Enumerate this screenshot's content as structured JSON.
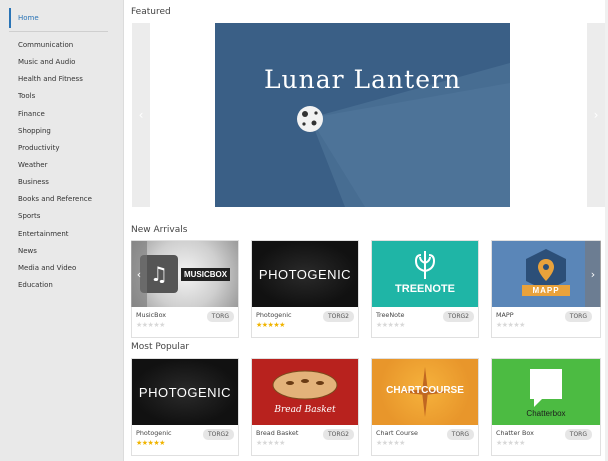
{
  "sidebar": {
    "home": "Home",
    "items": [
      {
        "label": "Communication"
      },
      {
        "label": "Music and Audio"
      },
      {
        "label": "Health and Fitness"
      },
      {
        "label": "Tools"
      },
      {
        "label": "Finance"
      },
      {
        "label": "Shopping"
      },
      {
        "label": "Productivity"
      },
      {
        "label": "Weather"
      },
      {
        "label": "Business"
      },
      {
        "label": "Books and Reference"
      },
      {
        "label": "Sports"
      },
      {
        "label": "Entertainment"
      },
      {
        "label": "News"
      },
      {
        "label": "Media and Video"
      },
      {
        "label": "Education"
      }
    ]
  },
  "featured": {
    "heading": "Featured",
    "banner_title": "Lunar Lantern"
  },
  "new_arrivals": {
    "heading": "New Arrivals",
    "apps": [
      {
        "name": "MusicBox",
        "badge": "TORG",
        "rating": 0,
        "logo_text": "MUSICBOX"
      },
      {
        "name": "Photogenic",
        "badge": "TORG2",
        "rating": 5,
        "logo_text": "PHOTOGENIC"
      },
      {
        "name": "TreeNote",
        "badge": "TORG2",
        "rating": 0,
        "logo_text": "TREENOTE"
      },
      {
        "name": "MAPP",
        "badge": "TORG",
        "rating": 0,
        "logo_text": "MAPP"
      }
    ]
  },
  "most_popular": {
    "heading": "Most Popular",
    "apps": [
      {
        "name": "Photogenic",
        "badge": "TORG2",
        "rating": 5,
        "logo_text": "PHOTOGENIC"
      },
      {
        "name": "Bread Basket",
        "badge": "TORG2",
        "rating": 0,
        "logo_text": "Bread Basket"
      },
      {
        "name": "Chart Course",
        "badge": "TORG",
        "rating": 0,
        "logo_text": "CHARTCOURSE"
      },
      {
        "name": "Chatter Box",
        "badge": "TORG",
        "rating": 0,
        "logo_text": "Chatterbox"
      }
    ]
  },
  "colors": {
    "accent": "#2a74b6",
    "sidebar_bg": "#e9e9e9",
    "star_on": "#f0b400",
    "star_off": "#d8d8d8"
  }
}
